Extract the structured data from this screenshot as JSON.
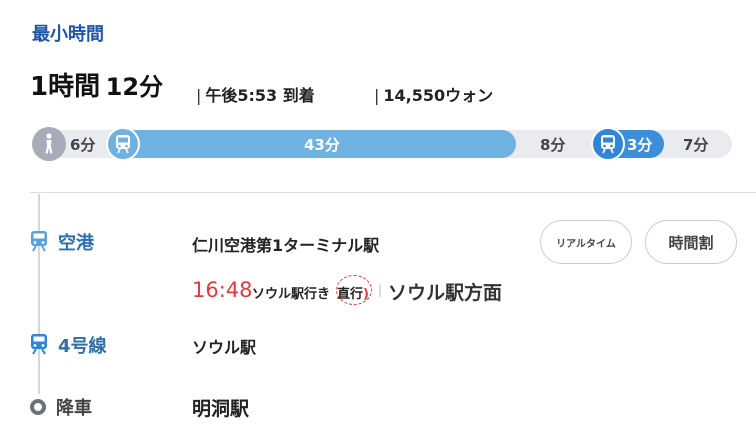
{
  "summary": {
    "category_label": "最小時間",
    "duration_hours": "1時間",
    "duration_minutes": "12分",
    "arrival_sep": "|",
    "arrival": "午後5:53 到着",
    "fare_sep": "|",
    "fare": "14,550ウォン"
  },
  "route_bar": {
    "walk_time": "6分",
    "train_time": "43分",
    "transfer_time": "8分",
    "train2_time": "3分",
    "final_walk_time": "7分"
  },
  "stops": {
    "board": {
      "label": "空港",
      "station": "仁川空港第1ターミナル駅",
      "realtime_button": "リアルタイム",
      "timetable_button": "時間割",
      "departure_time": "16:48",
      "train_dest": "ソウル駅行き",
      "express": "直行",
      "close_paren": ")",
      "divider": "|",
      "direction": "ソウル駅方面"
    },
    "transfer": {
      "label": "4号線",
      "station": "ソウル駅"
    },
    "alight": {
      "label": "降車",
      "station": "明洞駅"
    }
  },
  "colors": {
    "accent": "#1e56a8",
    "train_airport": "#6fb1e1",
    "train_line4": "#2f86d6",
    "time_red": "#e33b3b"
  },
  "icons": [
    "walk-icon",
    "train-icon",
    "stop-ring-icon"
  ]
}
